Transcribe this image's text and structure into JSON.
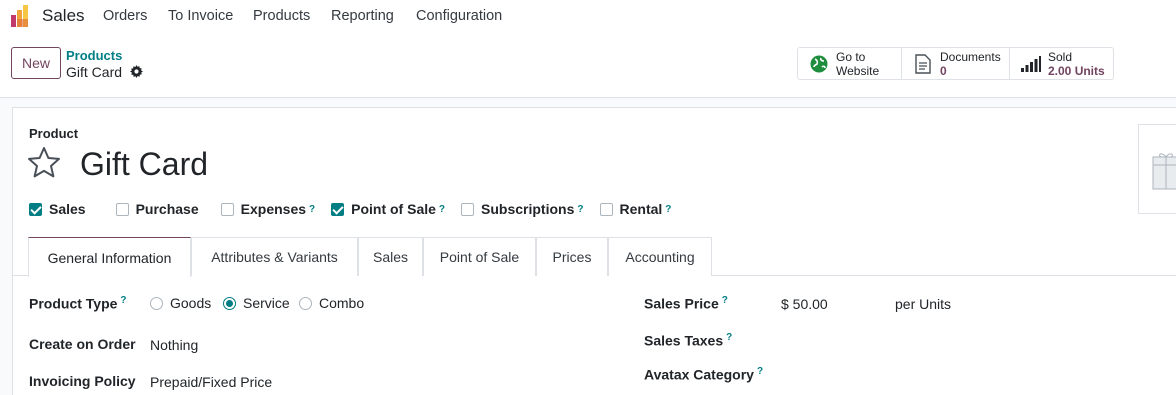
{
  "nav": {
    "app_name": "Sales",
    "items": [
      "Orders",
      "To Invoice",
      "Products",
      "Reporting",
      "Configuration"
    ]
  },
  "control_panel": {
    "new_label": "New",
    "breadcrumb_parent": "Products",
    "breadcrumb_current": "Gift Card",
    "stats": {
      "website": {
        "line1": "Go to",
        "line2": "Website"
      },
      "documents": {
        "label": "Documents",
        "value": "0"
      },
      "sold": {
        "label": "Sold",
        "value": "2.00 Units"
      }
    }
  },
  "form": {
    "product_label": "Product",
    "product_name": "Gift Card",
    "checkboxes": [
      {
        "label": "Sales",
        "checked": true,
        "help": false
      },
      {
        "label": "Purchase",
        "checked": false,
        "help": false
      },
      {
        "label": "Expenses",
        "checked": false,
        "help": true
      },
      {
        "label": "Point of Sale",
        "checked": true,
        "help": true
      },
      {
        "label": "Subscriptions",
        "checked": false,
        "help": true
      },
      {
        "label": "Rental",
        "checked": false,
        "help": true
      }
    ],
    "tabs": [
      "General Information",
      "Attributes & Variants",
      "Sales",
      "Point of Sale",
      "Prices",
      "Accounting"
    ],
    "help_mark": "?",
    "product_type": {
      "label": "Product Type",
      "options": [
        "Goods",
        "Service",
        "Combo"
      ],
      "selected": "Service"
    },
    "create_on_order": {
      "label": "Create on Order",
      "value": "Nothing"
    },
    "invoicing_policy": {
      "label": "Invoicing Policy",
      "value": "Prepaid/Fixed Price"
    },
    "sales_price": {
      "label": "Sales Price",
      "value": "$ 50.00",
      "unit": "per Units"
    },
    "sales_taxes": {
      "label": "Sales Taxes"
    },
    "avatax_category": {
      "label": "Avatax Category"
    }
  },
  "colors": {
    "brand": "#71445f",
    "accent": "#017e84"
  }
}
